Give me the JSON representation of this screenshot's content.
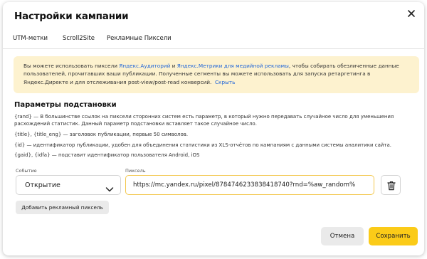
{
  "dialog": {
    "title": "Настройки кампании"
  },
  "tabs": [
    {
      "label": "UTM-метки",
      "active": false
    },
    {
      "label": "Scroll2Site",
      "active": false
    },
    {
      "label": "Рекламные Пиксели",
      "active": true
    }
  ],
  "banner": {
    "text_1": "Вы можете использовать пиксели ",
    "link_audiences": "Яндекс.Аудиторий",
    "text_2": " и ",
    "link_metrica": "Яндекс.Метрики для медийной рекламы",
    "text_3": ", чтобы собирать обезличенные данные пользователей, прочитавших ваши публикации. Полученные сегменты вы можете использовать для запуска ретаргетинга в Яндекс.Директе и для отслеживания post-view/post-read конверсий.",
    "hide_link": "Скрыть"
  },
  "params": {
    "title": "Параметры подстановки",
    "items": [
      "{rand} — В большинстве ссылок на пиксели сторонних систем есть параметр, в который нужно передавать случайное число для уменьшения расхождений статистик. Данный параметр подстановки вставляет такое случайное число.",
      "{title}, {title_eng} — заголовок публикации, первые 50 символов.",
      "{id} — идентификатор публикации, удобен для объединения статистики из XLS-отчётов по кампаниям с данными системы аналитики сайта.",
      "{gaid}, {idfa} — подставит идентификатор пользователя Android, iOS"
    ]
  },
  "form": {
    "event_label": "Событие",
    "event_value": "Открытие",
    "pixel_label": "Пиксель",
    "pixel_value": "https://mc.yandex.ru/pixel/8784746233838418740?rnd=%aw_random%"
  },
  "buttons": {
    "add_pixel": "Добавить рекламный пиксель",
    "cancel": "Отмена",
    "save": "Сохранить"
  },
  "colors": {
    "accent": "#fbcb18",
    "banner_bg": "#fdf2cf",
    "link": "#2166d8"
  },
  "icons": {
    "close": "close-icon",
    "chevron": "chevron-down-icon",
    "trash": "trash-icon"
  }
}
